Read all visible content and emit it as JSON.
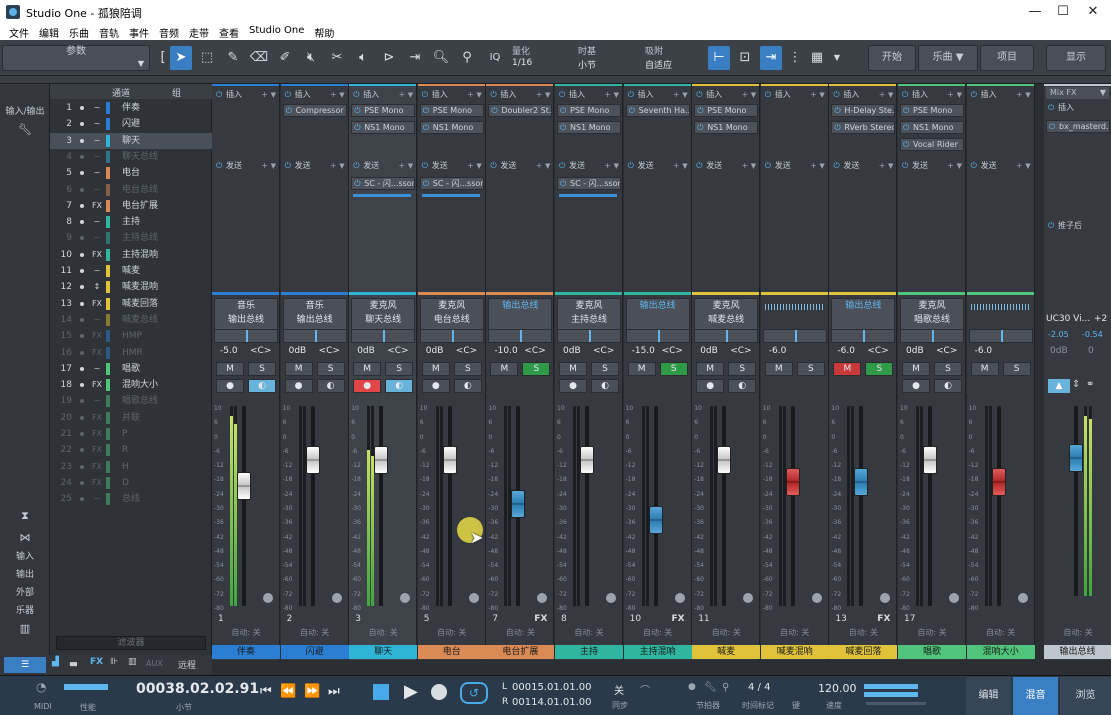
{
  "window": {
    "title": "Studio One - 孤狼陪调"
  },
  "menu": [
    "文件",
    "编辑",
    "乐曲",
    "音轨",
    "事件",
    "音频",
    "走带",
    "查看",
    "Studio One",
    "帮助"
  ],
  "toolbar": {
    "params_label": "参数",
    "quantize_label": "量化",
    "quantize_value": "1/16",
    "timebase_label": "时基",
    "timebase_value": "小节",
    "snap_label": "吸附",
    "snap_value": "自适应",
    "iq_label": "IQ",
    "start_label": "开始",
    "song_label": "乐曲",
    "project_label": "项目",
    "show_label": "显示"
  },
  "leftnav": {
    "io_label": "输入/输出",
    "input": "输入",
    "output": "输出",
    "external": "外部",
    "instruments": "乐器",
    "remote": "远程"
  },
  "chanlist": {
    "header_channel": "通道",
    "header_group": "组",
    "filter_label": "滤波器",
    "rows": [
      {
        "num": "1",
        "type": "~",
        "color": "#2a7fd4",
        "name": "伴奏",
        "dim": false,
        "sel": false
      },
      {
        "num": "2",
        "type": "~",
        "color": "#2a7fd4",
        "name": "闪避",
        "dim": false,
        "sel": false
      },
      {
        "num": "3",
        "type": "~",
        "color": "#2fb5d6",
        "name": "聊天",
        "dim": false,
        "sel": true
      },
      {
        "num": "4",
        "type": "~",
        "color": "#2fb5d6",
        "name": "聊天总线",
        "dim": true,
        "sel": false
      },
      {
        "num": "5",
        "type": "~",
        "color": "#d98a55",
        "name": "电台",
        "dim": false,
        "sel": false
      },
      {
        "num": "6",
        "type": "~",
        "color": "#d98a55",
        "name": "电台总线",
        "dim": true,
        "sel": false
      },
      {
        "num": "7",
        "type": "FX",
        "color": "#d98a55",
        "name": "电台扩展",
        "dim": false,
        "sel": false
      },
      {
        "num": "8",
        "type": "~",
        "color": "#2fb5a0",
        "name": "主持",
        "dim": false,
        "sel": false
      },
      {
        "num": "9",
        "type": "~",
        "color": "#2fb5a0",
        "name": "主持总线",
        "dim": true,
        "sel": false
      },
      {
        "num": "10",
        "type": "FX",
        "color": "#2fb5a0",
        "name": "主持混响",
        "dim": false,
        "sel": false
      },
      {
        "num": "11",
        "type": "~",
        "color": "#e0c33a",
        "name": "喊麦",
        "dim": false,
        "sel": false
      },
      {
        "num": "12",
        "type": "↕",
        "color": "#e0c33a",
        "name": "喊麦混响",
        "dim": false,
        "sel": false
      },
      {
        "num": "13",
        "type": "FX",
        "color": "#e0c33a",
        "name": "喊麦回落",
        "dim": false,
        "sel": false
      },
      {
        "num": "14",
        "type": "~",
        "color": "#e0c33a",
        "name": "喊麦总线",
        "dim": true,
        "sel": false
      },
      {
        "num": "15",
        "type": "FX",
        "color": "#2a7fd4",
        "name": "HMP",
        "dim": true,
        "sel": false
      },
      {
        "num": "16",
        "type": "FX",
        "color": "#2a7fd4",
        "name": "HMR",
        "dim": true,
        "sel": false
      },
      {
        "num": "17",
        "type": "~",
        "color": "#4fc47a",
        "name": "唱歌",
        "dim": false,
        "sel": false
      },
      {
        "num": "18",
        "type": "FX",
        "color": "#4fc47a",
        "name": "混响大小",
        "dim": false,
        "sel": false
      },
      {
        "num": "19",
        "type": "~",
        "color": "#4fc47a",
        "name": "唱歌总线",
        "dim": true,
        "sel": false
      },
      {
        "num": "20",
        "type": "FX",
        "color": "#4fc47a",
        "name": "并联",
        "dim": true,
        "sel": false
      },
      {
        "num": "21",
        "type": "FX",
        "color": "#4fc47a",
        "name": "P",
        "dim": true,
        "sel": false
      },
      {
        "num": "22",
        "type": "FX",
        "color": "#4fc47a",
        "name": "R",
        "dim": true,
        "sel": false
      },
      {
        "num": "23",
        "type": "FX",
        "color": "#4fc47a",
        "name": "H",
        "dim": true,
        "sel": false
      },
      {
        "num": "24",
        "type": "FX",
        "color": "#4fc47a",
        "name": "D",
        "dim": true,
        "sel": false
      },
      {
        "num": "25",
        "type": "~",
        "color": "#4fc47a",
        "name": "总线",
        "dim": true,
        "sel": false
      }
    ]
  },
  "mixer": {
    "insert_label": "插入",
    "send_label": "发送",
    "mute": "M",
    "solo": "S",
    "auto_label": "自动: 关",
    "scale": [
      "10",
      "6",
      "0",
      "-6",
      "-12",
      "-18",
      "-24",
      "-30",
      "-36",
      "-42",
      "-48",
      "-54",
      "-60",
      "-72",
      "-80"
    ],
    "strips": [
      {
        "num": "1",
        "name": "伴奏",
        "color": "#2a7fd4",
        "in": "音乐",
        "out": "输出总线",
        "db": "-5.0",
        "pan": "<C>",
        "plugins": [],
        "sends": [],
        "fader": "white",
        "level": 0.6,
        "meter": 0.95,
        "mute": false,
        "solo": false,
        "rec": false,
        "mon": true,
        "fx": false,
        "sel": false
      },
      {
        "num": "2",
        "name": "闪避",
        "color": "#2a7fd4",
        "in": "音乐",
        "out": "输出总线",
        "db": "0dB",
        "pan": "<C>",
        "plugins": [
          "Compressor"
        ],
        "sends": [],
        "fader": "white",
        "level": 0.73,
        "meter": 0,
        "mute": false,
        "solo": false,
        "rec": false,
        "mon": false,
        "fx": false,
        "sel": false
      },
      {
        "num": "3",
        "name": "聊天",
        "color": "#2fb5d6",
        "in": "麦克风",
        "out": "聊天总线",
        "db": "0dB",
        "pan": "<C>",
        "plugins": [
          "PSE Mono",
          "NS1 Mono"
        ],
        "sends": [
          "SC - 闪...ssor"
        ],
        "fader": "white",
        "level": 0.73,
        "meter": 0.78,
        "mute": false,
        "solo": false,
        "rec": true,
        "mon": true,
        "fx": false,
        "sel": true
      },
      {
        "num": "5",
        "name": "电台",
        "color": "#d98a55",
        "in": "麦克风",
        "out": "电台总线",
        "db": "0dB",
        "pan": "<C>",
        "plugins": [
          "PSE Mono",
          "NS1 Mono"
        ],
        "sends": [
          "SC - 闪...ssor"
        ],
        "fader": "white",
        "level": 0.73,
        "meter": 0,
        "mute": false,
        "solo": false,
        "rec": false,
        "mon": false,
        "fx": false,
        "sel": false
      },
      {
        "num": "7",
        "name": "电台扩展",
        "color": "#d98a55",
        "in": "",
        "out": "输出总线",
        "db": "-10.0",
        "pan": "<C>",
        "plugins": [
          "Doubler2 St..."
        ],
        "sends": [],
        "fader": "blue",
        "level": 0.51,
        "meter": 0,
        "mute": false,
        "solo": true,
        "rec": false,
        "mon": false,
        "fx": true,
        "sel": false
      },
      {
        "num": "8",
        "name": "主持",
        "color": "#2fb5a0",
        "in": "麦克风",
        "out": "主持总线",
        "db": "0dB",
        "pan": "<C>",
        "plugins": [
          "PSE Mono",
          "NS1 Mono"
        ],
        "sends": [
          "SC - 闪...ssor"
        ],
        "fader": "white",
        "level": 0.73,
        "meter": 0,
        "mute": false,
        "solo": false,
        "rec": false,
        "mon": false,
        "fx": false,
        "sel": false
      },
      {
        "num": "10",
        "name": "主持混响",
        "color": "#2fb5a0",
        "in": "",
        "out": "输出总线",
        "db": "-15.0",
        "pan": "<C>",
        "plugins": [
          "Seventh Ha..."
        ],
        "sends": [],
        "fader": "blue",
        "level": 0.43,
        "meter": 0,
        "mute": false,
        "solo": true,
        "rec": false,
        "mon": false,
        "fx": true,
        "sel": false
      },
      {
        "num": "11",
        "name": "喊麦",
        "color": "#e0c33a",
        "in": "麦克风",
        "out": "喊麦总线",
        "db": "0dB",
        "pan": "<C>",
        "plugins": [
          "PSE Mono",
          "NS1 Mono"
        ],
        "sends": [],
        "fader": "white",
        "level": 0.73,
        "meter": 0,
        "mute": false,
        "solo": false,
        "rec": false,
        "mon": false,
        "fx": false,
        "sel": false
      },
      {
        "num": "",
        "name": "喊麦混响",
        "color": "#e0c33a",
        "in": "",
        "out": "",
        "db": "-6.0",
        "pan": "",
        "plugins": [],
        "sends": [],
        "fader": "red",
        "level": 0.62,
        "meter": 0,
        "mute": false,
        "solo": false,
        "rec": false,
        "mon": false,
        "fx": false,
        "sel": false
      },
      {
        "num": "13",
        "name": "喊麦回落",
        "color": "#e0c33a",
        "in": "",
        "out": "输出总线",
        "db": "-6.0",
        "pan": "<C>",
        "plugins": [
          "H-Delay Ste...",
          "RVerb Stereo"
        ],
        "sends": [],
        "fader": "blue",
        "level": 0.62,
        "meter": 0,
        "mute": true,
        "solo": true,
        "rec": false,
        "mon": false,
        "fx": true,
        "sel": false
      },
      {
        "num": "17",
        "name": "唱歌",
        "color": "#4fc47a",
        "in": "麦克风",
        "out": "唱歌总线",
        "db": "0dB",
        "pan": "<C>",
        "plugins": [
          "PSE Mono",
          "NS1 Mono",
          "Vocal Rider"
        ],
        "sends": [],
        "fader": "white",
        "level": 0.73,
        "meter": 0,
        "mute": false,
        "solo": false,
        "rec": false,
        "mon": false,
        "fx": false,
        "sel": false
      },
      {
        "num": "",
        "name": "混响大小",
        "color": "#4fc47a",
        "in": "",
        "out": "",
        "db": "-6.0",
        "pan": "",
        "plugins": [],
        "sends": [],
        "fader": "red",
        "level": 0.62,
        "meter": 0,
        "mute": false,
        "solo": false,
        "rec": false,
        "mon": false,
        "fx": false,
        "sel": false
      }
    ],
    "mixfx": {
      "title": "Mix FX",
      "insert": "插入",
      "plugin": "bx_masterd...",
      "post": "推子后",
      "name": "UC30 Vi...",
      "pan": "+2",
      "val1": "-2.05",
      "val2": "-0.54",
      "db": "0dB",
      "panv": "0",
      "bus_name": "输出总线"
    }
  },
  "mixtools": {
    "aux": "AUX",
    "remote": "远程"
  },
  "transport": {
    "midi": "MIDI",
    "perf": "性能",
    "position": "00038.02.02.91",
    "position_unit": "小节",
    "loop_l": "00015.01.01.00",
    "loop_r": "00114.01.01.00",
    "L": "L",
    "R": "R",
    "sync": "关",
    "sync_label": "同步",
    "metronome": "节拍器",
    "timesig": "4 / 4",
    "timesig_label": "时间标记",
    "key_label": "键",
    "tempo": "120.00",
    "tempo_label": "速度",
    "edit": "编辑",
    "mix": "混音",
    "browse": "浏览"
  }
}
